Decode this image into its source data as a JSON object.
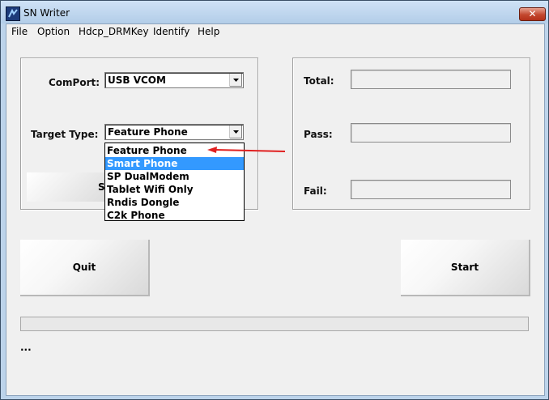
{
  "window": {
    "title": "SN Writer",
    "close_glyph": "✕"
  },
  "menu": [
    "File",
    "Option",
    "Hdcp_DRMKey",
    "Identify",
    "Help"
  ],
  "left_group": {
    "comport_label": "ComPort:",
    "comport_value": "USB VCOM",
    "target_label": "Target Type:",
    "target_value": "Feature Phone",
    "hidden_button_fragment": "S"
  },
  "target_dropdown": {
    "options": [
      "Feature Phone",
      "Smart Phone",
      "SP DualModem",
      "Tablet Wifi Only",
      "Rndis Dongle",
      "C2k Phone"
    ],
    "highlighted": "Smart Phone"
  },
  "right_group": {
    "total_label": "Total:",
    "pass_label": "Pass:",
    "fail_label": "Fail:",
    "total_value": "",
    "pass_value": "",
    "fail_value": ""
  },
  "buttons": {
    "quit": "Quit",
    "start": "Start"
  },
  "status_text": "...",
  "colors": {
    "highlight": "#3399ff",
    "annotation_arrow": "#e02020",
    "close_button": "#c3472e"
  },
  "icons": {
    "app": "sn-writer-app-icon",
    "combo_arrow": "chevron-down-icon",
    "annotation": "red-arrow-icon"
  }
}
